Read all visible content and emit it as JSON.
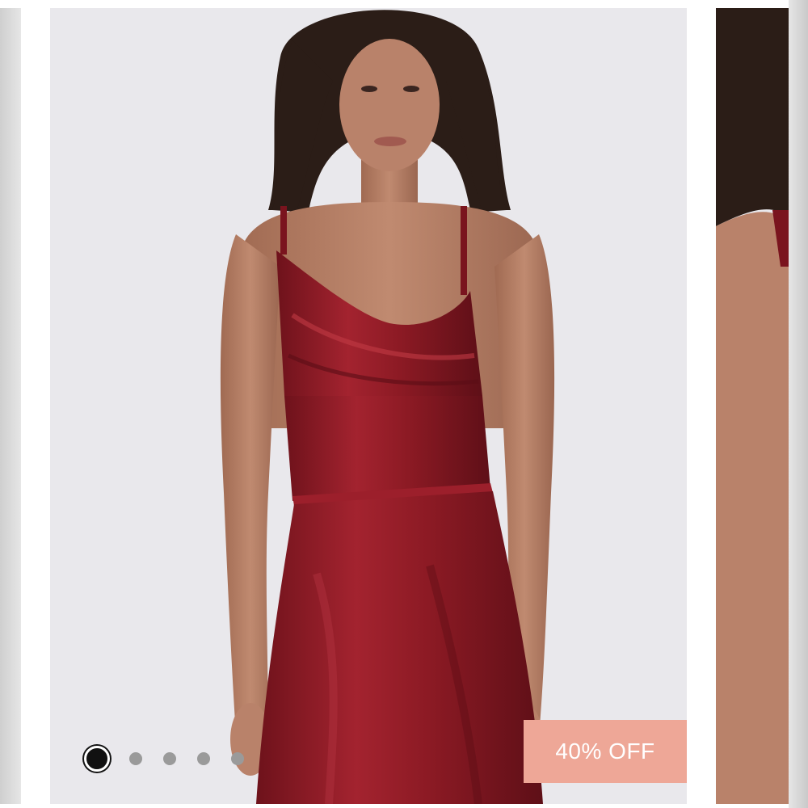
{
  "carousel": {
    "slide_count": 5,
    "active_index": 0,
    "badge_text": "40% OFF"
  },
  "colors": {
    "backdrop": "#e9e8ec",
    "dress": "#8c1a24",
    "dress_highlight": "#b02a36",
    "badge": "#eea797",
    "skin": "#b9826a",
    "hair": "#2b1d17"
  }
}
